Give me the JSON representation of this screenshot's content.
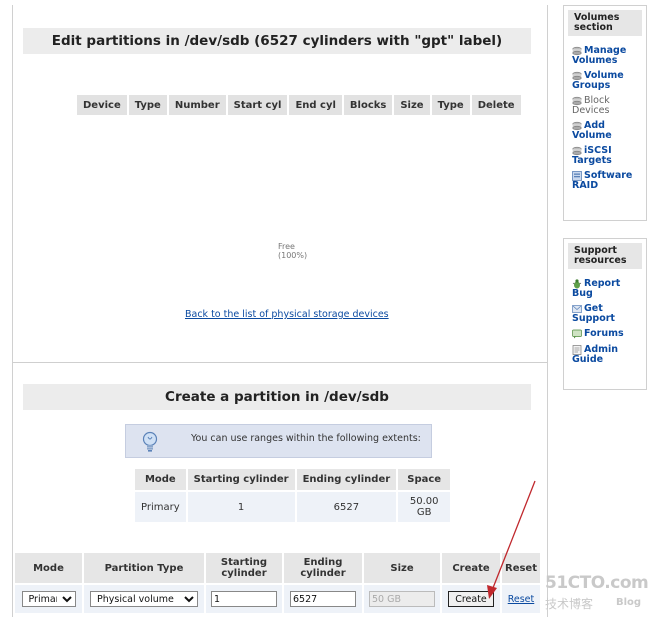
{
  "edit": {
    "title": "Edit partitions in /dev/sdb (6527 cylinders with \"gpt\" label)",
    "columns": [
      "Device",
      "Type",
      "Number",
      "Start cyl",
      "End cyl",
      "Blocks",
      "Size",
      "Type",
      "Delete"
    ],
    "free_label": "Free",
    "free_pct": "(100%)",
    "back_link": "Back to the list of physical storage devices"
  },
  "create": {
    "title": "Create a partition in /dev/sdb",
    "info_text": "You can use ranges within the following extents:",
    "extents": {
      "headers": [
        "Mode",
        "Starting cylinder",
        "Ending cylinder",
        "Space"
      ],
      "rows": [
        [
          "Primary",
          "1",
          "6527",
          "50.00 GB"
        ]
      ]
    },
    "form": {
      "headers": [
        "Mode",
        "Partition Type",
        "Starting cylinder",
        "Ending cylinder",
        "Size",
        "Create",
        "Reset"
      ],
      "mode_value": "Primary",
      "partition_type_value": "Physical volume",
      "starting_cylinder": "1",
      "ending_cylinder": "6527",
      "size_value": "50 GB",
      "create_label": "Create",
      "reset_label": "Reset"
    }
  },
  "volumes_panel": {
    "title": "Volumes section",
    "items": [
      {
        "label": "Manage Volumes",
        "icon": "disk-icon"
      },
      {
        "label": "Volume Groups",
        "icon": "disk-icon"
      },
      {
        "label": "Block Devices",
        "icon": "disk-icon"
      },
      {
        "label": "Add Volume",
        "icon": "disk-icon"
      },
      {
        "label": "iSCSI Targets",
        "icon": "disk-icon"
      },
      {
        "label": "Software RAID",
        "icon": "raid-icon"
      }
    ]
  },
  "support_panel": {
    "title": "Support resources",
    "items": [
      {
        "label": "Report Bug",
        "icon": "bug-icon"
      },
      {
        "label": "Get Support",
        "icon": "support-icon"
      },
      {
        "label": "Forums",
        "icon": "forums-icon"
      },
      {
        "label": "Admin Guide",
        "icon": "guide-icon"
      }
    ]
  },
  "watermark": {
    "brand": "51CTO.com",
    "sub": "技术博客",
    "blog": "Blog"
  },
  "colors": {
    "link": "#0b4aa0",
    "header_bg": "#ececec",
    "arrow": "#c0282d"
  }
}
